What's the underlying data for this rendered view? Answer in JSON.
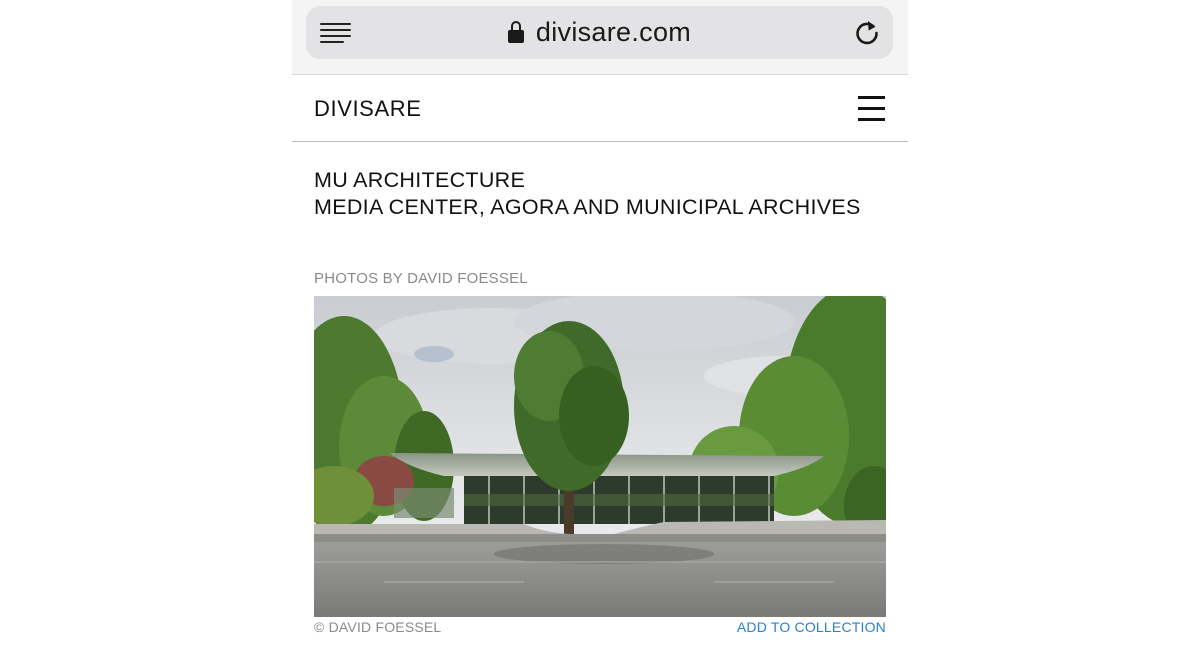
{
  "browser": {
    "url": "divisare.com",
    "icons": {
      "reader": "reader-mode-icon",
      "lock": "lock-icon",
      "reload": "reload-icon"
    }
  },
  "site": {
    "logo": "DIVISARE",
    "menu_icon": "hamburger-menu-icon"
  },
  "article": {
    "architect": "MU ARCHITECTURE",
    "project": "MEDIA CENTER, AGORA AND MUNICIPAL ARCHIVES",
    "photos_by": "PHOTOS BY DAVID FOESSEL",
    "photo_credit": "© DAVID FOESSEL",
    "add_to_collection": "ADD TO COLLECTION"
  },
  "colors": {
    "link": "#2c7fd0",
    "muted": "#8a8a8a",
    "text": "#111111",
    "chrome_bg": "#f4f4f4",
    "url_pill": "#e3e3e5"
  }
}
